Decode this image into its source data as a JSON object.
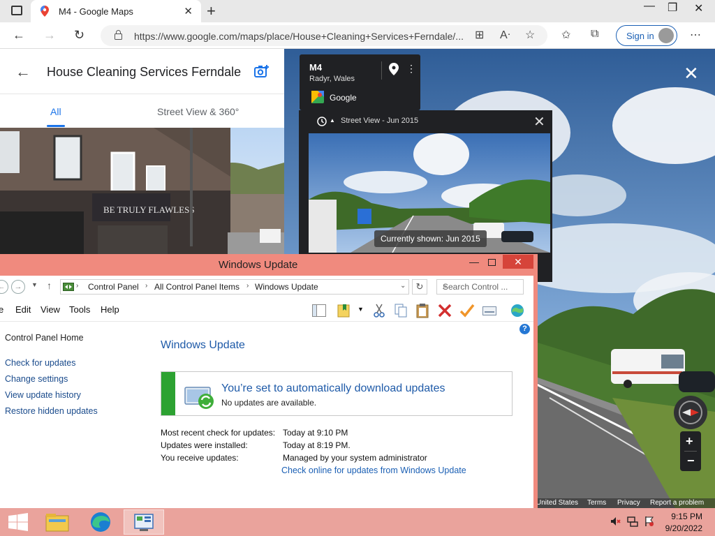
{
  "browser": {
    "tab_title": "M4 - Google Maps",
    "url": "https://www.google.com/maps/place/House+Cleaning+Services+Ferndale/...",
    "sign_in_label": "Sign in"
  },
  "maps_panel": {
    "title": "House Cleaning Services Ferndale",
    "tabs": [
      "All",
      "Street View & 360°"
    ],
    "active_tab": "All",
    "photo_sign": "BE TRULY FLAWLESS"
  },
  "street_view": {
    "location_name": "M4",
    "location_sub": "Radyr, Wales",
    "provider": "Google",
    "history_label": "Street View - Jun 2015",
    "currently_shown": "Currently shown: Jun 2015",
    "footer_links": [
      "United States",
      "Terms",
      "Privacy",
      "Report a problem"
    ]
  },
  "windows_update": {
    "title": "Windows Update",
    "breadcrumb": [
      "Control Panel",
      "All Control Panel Items",
      "Windows Update"
    ],
    "search_placeholder": "Search Control ...",
    "menu": [
      "e",
      "Edit",
      "View",
      "Tools",
      "Help"
    ],
    "left_nav": {
      "home": "Control Panel Home",
      "links": [
        "Check for updates",
        "Change settings",
        "View update history",
        "Restore hidden updates"
      ]
    },
    "heading": "Windows Update",
    "status_title": "You’re set to automatically download updates",
    "status_sub": "No updates are available.",
    "details": [
      {
        "label": "Most recent check for updates:",
        "value": "Today at 9:10 PM"
      },
      {
        "label": "Updates were installed:",
        "value": "Today at 8:19 PM."
      },
      {
        "label": "You receive updates:",
        "value": "Managed by your system administrator"
      }
    ],
    "online_link": "Check online for updates from Windows Update"
  },
  "taskbar": {
    "time": "9:15 PM",
    "date": "9/20/2022",
    "accent": "#eaa39c"
  }
}
